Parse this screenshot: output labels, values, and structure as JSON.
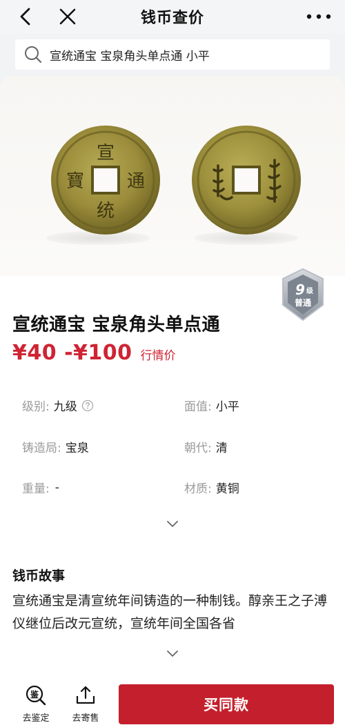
{
  "nav": {
    "title": "钱币查价"
  },
  "search": {
    "query": "宣统通宝 宝泉角头单点通 小平"
  },
  "coin": {
    "badge_number": "9",
    "badge_unit": "级",
    "badge_label": "普通",
    "title": "宣统通宝 宝泉角头单点通",
    "price_range": "¥40 -¥100",
    "price_link": "行情价",
    "obverse_chars": {
      "top": "宣",
      "right": "通",
      "bottom": "统",
      "left": "寶"
    }
  },
  "attributes": {
    "level_key": "级别:",
    "level_val": "九级",
    "face_key": "面值:",
    "face_val": "小平",
    "mint_key": "铸造局:",
    "mint_val": "宝泉",
    "dynasty_key": "朝代:",
    "dynasty_val": "清",
    "weight_key": "重量:",
    "weight_val": "-",
    "material_key": "材质:",
    "material_val": "黄铜"
  },
  "story": {
    "title": "钱币故事",
    "text": "宣统通宝是清宣统年间铸造的一种制钱。醇亲王之子溥仪继位后改元宣统，宣统年间全国各省"
  },
  "bottom_bar": {
    "appraise_label": "去鉴定",
    "consign_label": "去寄售",
    "buy_label": "买同款"
  },
  "colors": {
    "accent": "#cf2333",
    "buy_button": "#c41f2c",
    "coin_gold": "#9c8f3c"
  }
}
